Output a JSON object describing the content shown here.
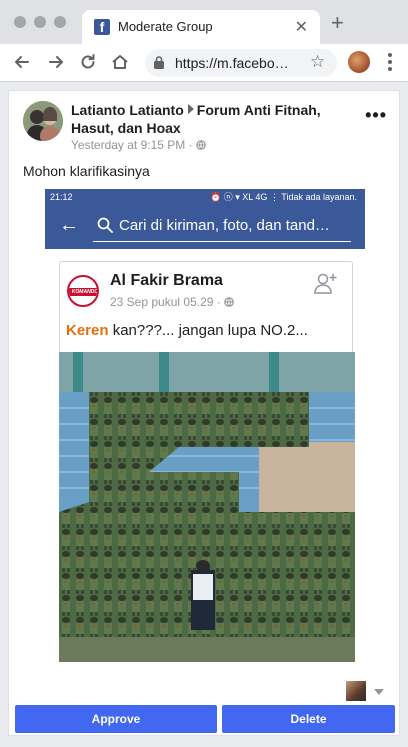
{
  "browser": {
    "tab_title": "Moderate Group",
    "favicon_letter": "f",
    "tab_close": "✕",
    "new_tab": "+",
    "url": "https://m.facebo…",
    "star": "☆"
  },
  "post": {
    "author": "Latianto Latianto",
    "group": "Forum Anti Fitnah, Hasut, dan Hoax",
    "timestamp": "Yesterday at 9:15 PM",
    "separator": " · ",
    "menu": "•••",
    "text": "Mohon klarifikasinya"
  },
  "embedded": {
    "status_left": "21:12",
    "status_right": "⏰ ⓝ ▾ XL 4G ⋮ Tidak ada layanan.",
    "back": "←",
    "search_placeholder": "Cari di kiriman, foto, dan tand…",
    "page_name": "Al Fakir Brama",
    "logo_text": "KOMANDO",
    "page_meta": "23 Sep pukul 05.29 ·",
    "caption_keyword": "Keren",
    "caption_rest": " kan???... jangan lupa NO.2..."
  },
  "actions": {
    "approve": "Approve",
    "delete": "Delete"
  },
  "colors": {
    "facebook_blue": "#3b5998",
    "button_blue": "#4267f0",
    "keyword_orange": "#e07010"
  }
}
